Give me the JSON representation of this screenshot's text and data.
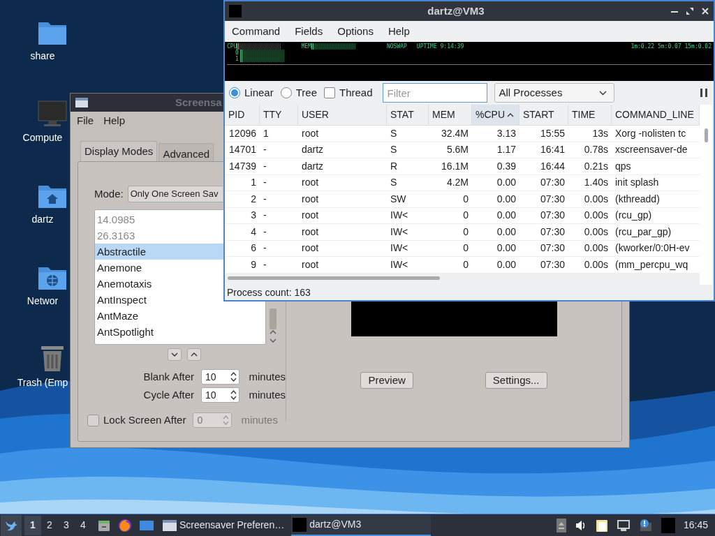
{
  "desktop_icons": [
    {
      "label": "share",
      "kind": "folder"
    },
    {
      "label": "Compute",
      "kind": "computer"
    },
    {
      "label": "dartz",
      "kind": "home"
    },
    {
      "label": "Networ",
      "kind": "network"
    },
    {
      "label": "Trash (Emp",
      "kind": "trash"
    }
  ],
  "screensaver": {
    "title": "Screensa",
    "menu": [
      "File",
      "Help"
    ],
    "tabs": [
      {
        "label": "Display Modes",
        "selected": true
      },
      {
        "label": "Advanced",
        "selected": false
      }
    ],
    "mode_label": "Mode:",
    "mode_value": "Only One Screen Sav",
    "modes": [
      {
        "label": "14.0985",
        "disabled": true,
        "selected": false
      },
      {
        "label": "26.3163",
        "disabled": true,
        "selected": false
      },
      {
        "label": "Abstractile",
        "disabled": false,
        "selected": true
      },
      {
        "label": "Anemone",
        "disabled": false,
        "selected": false
      },
      {
        "label": "Anemotaxis",
        "disabled": false,
        "selected": false
      },
      {
        "label": "AntInspect",
        "disabled": false,
        "selected": false
      },
      {
        "label": "AntMaze",
        "disabled": false,
        "selected": false
      },
      {
        "label": "AntSpotlight",
        "disabled": false,
        "selected": false
      }
    ],
    "timers": [
      {
        "kind": "plain",
        "label": "Blank After",
        "value": "10",
        "unit": "minutes",
        "disabled": false
      },
      {
        "kind": "plain",
        "label": "Cycle After",
        "value": "10",
        "unit": "minutes",
        "disabled": false
      },
      {
        "kind": "checkbox",
        "label": "Lock Screen After",
        "value": "0",
        "unit": "minutes",
        "checked": false,
        "disabled": true
      }
    ],
    "buttons": [
      "Preview",
      "Settings..."
    ]
  },
  "qps": {
    "title": "dartz@VM3",
    "menu": [
      "Command",
      "Fields",
      "Options",
      "Help"
    ],
    "monitor": {
      "cpu": "CPU",
      "mem": "MEM",
      "swap": "NOSWAP",
      "uptime": "UPTIME 9:14:39",
      "load": "1m:0.22 5m:0.07 15m:0.02",
      "cores": [
        "0",
        "1"
      ]
    },
    "views": [
      {
        "label": "Linear",
        "selected": true
      },
      {
        "label": "Tree",
        "selected": false
      }
    ],
    "thread": {
      "label": "Thread",
      "checked": false
    },
    "filter": {
      "placeholder": "Filter"
    },
    "process_filter": "All Processes",
    "columns": [
      {
        "label": "PID",
        "kind": "number",
        "sorted": false
      },
      {
        "label": "TTY",
        "kind": "text",
        "sorted": false
      },
      {
        "label": "USER",
        "kind": "text",
        "sorted": false
      },
      {
        "label": "STAT",
        "kind": "text",
        "sorted": false
      },
      {
        "label": "MEM",
        "kind": "number",
        "sorted": false
      },
      {
        "label": "%CPU",
        "kind": "number",
        "sorted": true
      },
      {
        "label": "START",
        "kind": "number",
        "sorted": false
      },
      {
        "label": "TIME",
        "kind": "number",
        "sorted": false
      },
      {
        "label": "COMMAND_LINE",
        "kind": "text",
        "sorted": false
      }
    ],
    "rows": [
      [
        "12096",
        "1",
        "root",
        "S",
        "32.4M",
        "3.13",
        "15:55",
        "13s",
        "Xorg -nolisten tc"
      ],
      [
        "14701",
        "-",
        "dartz",
        "S",
        "5.6M",
        "1.17",
        "16:41",
        "0.78s",
        "xscreensaver-de"
      ],
      [
        "14739",
        "-",
        "dartz",
        "R",
        "16.1M",
        "0.39",
        "16:44",
        "0.21s",
        "qps"
      ],
      [
        "1",
        "-",
        "root",
        "S",
        "4.2M",
        "0.00",
        "07:30",
        "1.40s",
        "init splash"
      ],
      [
        "2",
        "-",
        "root",
        "SW",
        "0",
        "0.00",
        "07:30",
        "0.00s",
        "(kthreadd)"
      ],
      [
        "3",
        "-",
        "root",
        "IW<",
        "0",
        "0.00",
        "07:30",
        "0.00s",
        "(rcu_gp)"
      ],
      [
        "4",
        "-",
        "root",
        "IW<",
        "0",
        "0.00",
        "07:30",
        "0.00s",
        "(rcu_par_gp)"
      ],
      [
        "6",
        "-",
        "root",
        "IW<",
        "0",
        "0.00",
        "07:30",
        "0.00s",
        "(kworker/0:0H-ev"
      ],
      [
        "9",
        "-",
        "root",
        "IW<",
        "0",
        "0.00",
        "07:30",
        "0.00s",
        "(mm_percpu_wq"
      ]
    ],
    "status": "Process count: 163"
  },
  "taskbar": {
    "workspaces": [
      {
        "label": "1",
        "selected": true
      },
      {
        "label": "2",
        "selected": false
      },
      {
        "label": "3",
        "selected": false
      },
      {
        "label": "4",
        "selected": false
      }
    ],
    "tasks": [
      {
        "label": "Screensaver Preferen…",
        "active": false,
        "kind": "window"
      },
      {
        "label": "dartz@VM3",
        "active": true,
        "kind": "terminal"
      }
    ],
    "clock": "16:45"
  }
}
